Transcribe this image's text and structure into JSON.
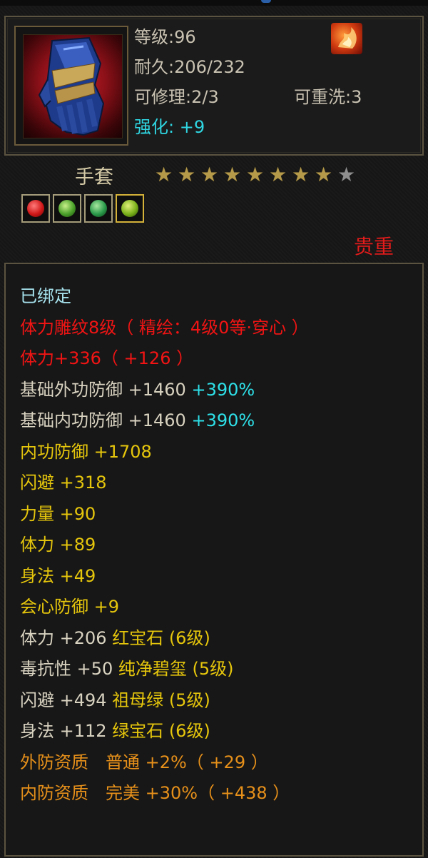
{
  "header": {
    "level": "等级:96",
    "durability": "耐久:206/232",
    "repair": "可修理:2/3",
    "rewash": "可重洗:3",
    "enhance": "强化: +9"
  },
  "item": {
    "name": "手套",
    "stars_total": 9,
    "stars_filled": 8,
    "gems": [
      "red-gem",
      "green-gem",
      "jade-gem",
      "yellow-green-gem"
    ],
    "rarity": "贵重"
  },
  "attributes": {
    "bound": "已绑定",
    "engrave": "体力雕纹8级（ 精绘：4级0等·穿心 ）",
    "stamina_main": "体力+336（ +126 ）",
    "base_outer_def": "基础外功防御 +1460",
    "base_outer_def_pct": "+390%",
    "base_inner_def": "基础内功防御 +1460",
    "base_inner_def_pct": "+390%",
    "inner_def": "内功防御 +1708",
    "dodge": "闪避 +318",
    "strength": "力量 +90",
    "stamina": "体力 +89",
    "agility": "身法 +49",
    "crit_def": "会心防御 +9",
    "gem_line_1_label": "体力 +206",
    "gem_line_1_gem": "红宝石 (6级)",
    "gem_line_2_label": "毒抗性 +50",
    "gem_line_2_gem": "纯净碧玺 (5级)",
    "gem_line_3_label": "闪避 +494",
    "gem_line_3_gem": "祖母绿 (5级)",
    "gem_line_4_label": "身法 +112",
    "gem_line_4_gem": "绿宝石 (6级)",
    "outer_quality": "外防资质　普通 +2%（ +29 ）",
    "inner_quality": "内防资质　完美 +30%（ +438 ）"
  },
  "colors": {
    "bound": "#a7e3ee",
    "engrave": "#f21414",
    "white_attr": "#d8d2c0",
    "yellow_attr": "#e6c60c",
    "quality": "#e6901a",
    "percent": "#2ee0e8",
    "rarity": "#e21b1b",
    "star_on": "#b59a4a",
    "star_off": "#8e8e8e"
  }
}
